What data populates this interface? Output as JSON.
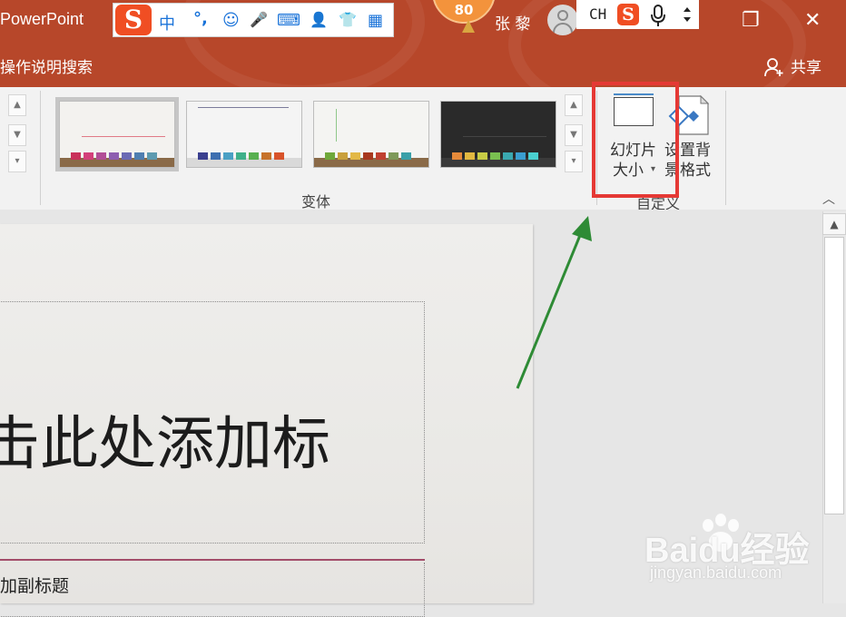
{
  "app": {
    "title": "PowerPoint",
    "tell_me": "操作说明搜索",
    "share": "共享",
    "user_name": "张 黎"
  },
  "ime": {
    "items": [
      "中",
      "°,",
      "☺",
      "🎤",
      "⌨",
      "👤",
      "👕",
      "▦"
    ],
    "logo": "S"
  },
  "ime_mini": {
    "lang": "CH",
    "logo": "S"
  },
  "badge": {
    "value": "80"
  },
  "window": {
    "restore": "❐",
    "close": "✕"
  },
  "ribbon": {
    "variants_label": "变体",
    "customize_label": "自定义",
    "slide_size_label_1": "幻灯片",
    "slide_size_label_2": "大小",
    "format_bg_label_1": "设置背",
    "format_bg_label_2": "景格式",
    "variant_thumbnails": [
      {
        "name": "variant-1",
        "bg": "#f3f2ef",
        "line": "#e07a86",
        "colors": [
          "#c9305a",
          "#d3407a",
          "#b24e96",
          "#8e5fb0",
          "#6a6ab4",
          "#4f7fb0",
          "#5d9bb0"
        ]
      },
      {
        "name": "variant-2",
        "bg": "#f4f4f4",
        "line": "#7a7a9a",
        "colors": [
          "#3a3f8f",
          "#3d6fb0",
          "#4aa0c4",
          "#3fb08a",
          "#58b050",
          "#c6722a",
          "#d8532a"
        ]
      },
      {
        "name": "variant-3",
        "bg": "#f4f4f2",
        "line": "#8fc88a",
        "colors": [
          "#6fa83a",
          "#c9a03c",
          "#e3b845",
          "#a8381e",
          "#c04030",
          "#7f9a5a",
          "#3aa0a8"
        ]
      },
      {
        "name": "variant-4",
        "bg": "#2a2a2a",
        "line": "#444444",
        "colors": [
          "#e58a3a",
          "#e2b840",
          "#c8cc45",
          "#7ac050",
          "#3aa8b0",
          "#3a9ed0",
          "#4ad0d0"
        ]
      }
    ]
  },
  "slide": {
    "title_placeholder": "击此处添加标",
    "subtitle_placeholder": "加副标题"
  },
  "watermark": {
    "main": "Baidu经验",
    "sub": "jingyan.baidu.com"
  },
  "colors": {
    "accent": "#b7472a",
    "highlight_box": "#e53935",
    "arrow": "#2e8b35"
  }
}
